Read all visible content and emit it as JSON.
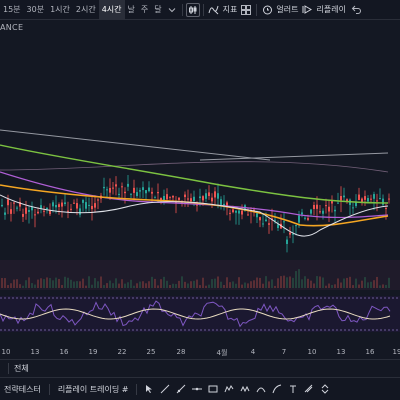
{
  "toolbar": {
    "timeframes": [
      "15분",
      "30분",
      "1시간",
      "2시간",
      "4시간",
      "날",
      "주",
      "달"
    ],
    "active_timeframe": "4시간",
    "indicators_label": "지표",
    "alert_label": "얼러트",
    "replay_label": "리플레이"
  },
  "ticker_fragment": "ANCE",
  "x_axis": {
    "labels": [
      "10",
      "13",
      "16",
      "19",
      "22",
      "25",
      "28",
      "4월",
      "4",
      "7",
      "10",
      "13",
      "16",
      "19"
    ]
  },
  "range_bar": {
    "label": "전체"
  },
  "bottom_bar": {
    "strategy_tester": "전략테스터",
    "replay_panel": "리플레이 트레이딩 #"
  },
  "colors": {
    "background": "#141823",
    "up": "#26a69a",
    "down": "#ef5350",
    "ma_green": "#7cc241",
    "ma_orange": "#f5a623",
    "ma_purple": "#b05fd6",
    "ma_white": "#dfe1e8",
    "trend_grey": "#9598a1",
    "oscillator": "#7e57c2",
    "oscillator_signal": "#e9dcc0"
  },
  "icons": [
    "candle-style-icon",
    "indicator-icon",
    "alert-clock-icon",
    "replay-icon",
    "undo-icon"
  ]
}
